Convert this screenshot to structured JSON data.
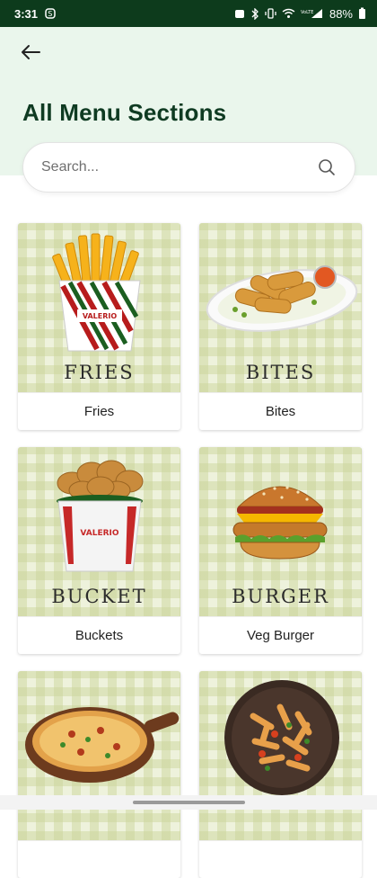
{
  "status": {
    "time": "3:31",
    "battery": "88%"
  },
  "header": {
    "back_icon": "arrow-left-icon",
    "title": "All Menu Sections"
  },
  "search": {
    "placeholder": "Search..."
  },
  "menu": [
    {
      "banner": "FRIES",
      "label": "Fries"
    },
    {
      "banner": "BITES",
      "label": "Bites"
    },
    {
      "banner": "BUCKET",
      "label": "Buckets"
    },
    {
      "banner": "BURGER",
      "label": "Veg Burger"
    },
    {
      "banner": "",
      "label": ""
    },
    {
      "banner": "",
      "label": ""
    }
  ],
  "brand_text": "VALERIO"
}
